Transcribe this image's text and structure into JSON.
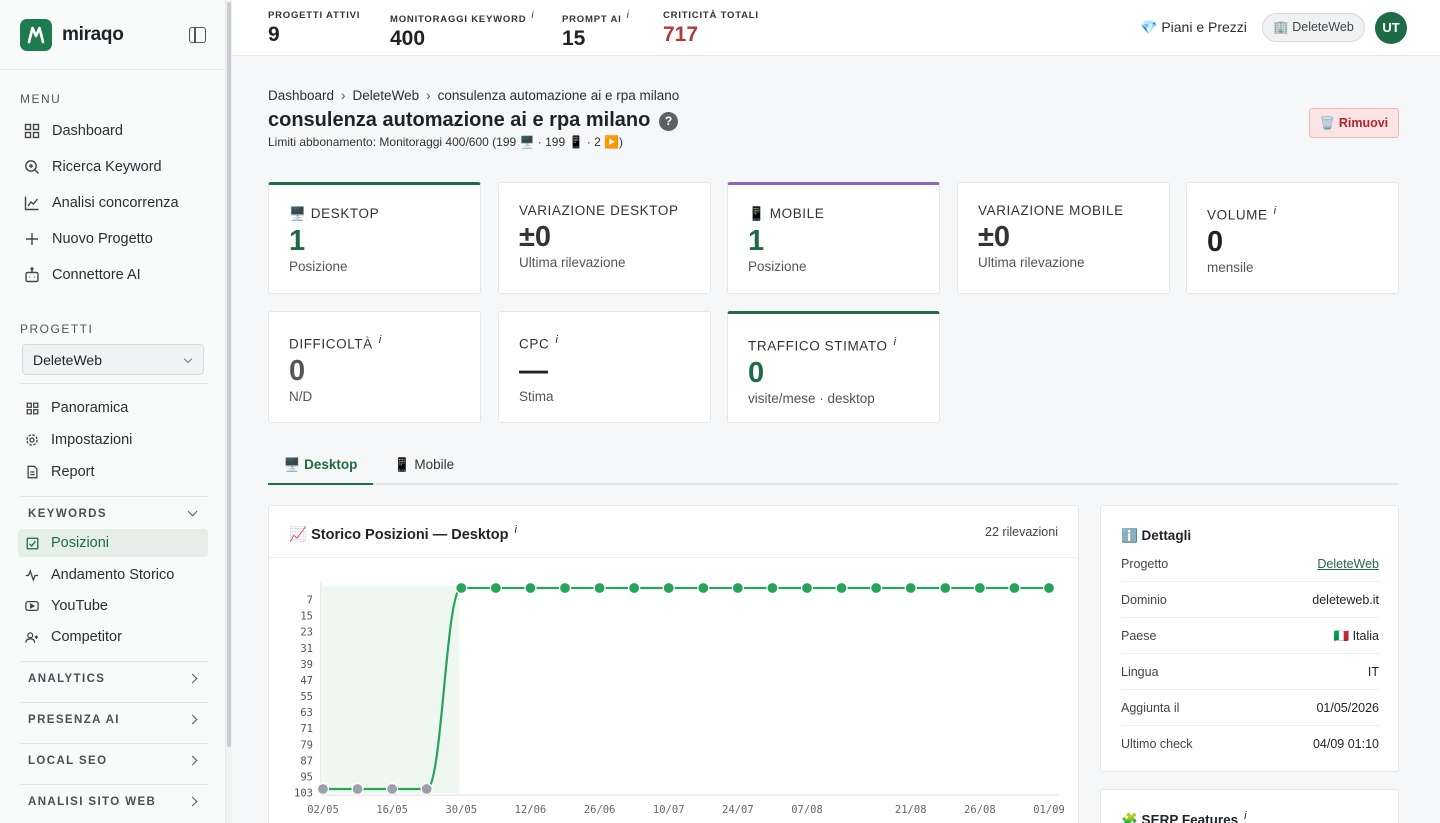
{
  "brand": {
    "name": "miraqo",
    "logo_letter": "M"
  },
  "sidebar": {
    "menu_label": "MENU",
    "menu": [
      {
        "label": "Dashboard",
        "icon": "grid-icon"
      },
      {
        "label": "Ricerca Keyword",
        "icon": "search-icon"
      },
      {
        "label": "Analisi concorrenza",
        "icon": "line-chart-icon"
      },
      {
        "label": "Nuovo Progetto",
        "icon": "plus-icon"
      },
      {
        "label": "Connettore AI",
        "icon": "robot-icon"
      }
    ],
    "projects_label": "PROGETTI",
    "selected_project": "DeleteWeb",
    "project_nav": [
      {
        "label": "Panoramica",
        "icon": "grid-icon"
      },
      {
        "label": "Impostazioni",
        "icon": "gear-icon"
      },
      {
        "label": "Report",
        "icon": "document-icon"
      }
    ],
    "keywords_group": "KEYWORDS",
    "keywords_items": [
      {
        "label": "Posizioni",
        "icon": "check-square-icon",
        "active": true
      },
      {
        "label": "Andamento Storico",
        "icon": "pulse-icon"
      },
      {
        "label": "YouTube",
        "icon": "youtube-icon"
      },
      {
        "label": "Competitor",
        "icon": "users-icon"
      }
    ],
    "collapsed_groups": [
      "ANALYTICS",
      "PRESENZA AI",
      "LOCAL SEO",
      "ANALISI SITO WEB"
    ]
  },
  "topbar": {
    "stats": [
      {
        "label": "PROGETTI ATTIVI",
        "value": "9",
        "info": false
      },
      {
        "label": "MONITORAGGI KEYWORD",
        "value": "400",
        "info": true
      },
      {
        "label": "PROMPT AI",
        "value": "15",
        "info": true
      },
      {
        "label": "CRITICITÀ TOTALI",
        "value": "717",
        "info": false,
        "color": "#b23a3a"
      }
    ],
    "pricing_link": "💎 Piani e Prezzi",
    "workspace": "🏢 DeleteWeb",
    "avatar_initials": "UT"
  },
  "page": {
    "breadcrumb": [
      "Dashboard",
      "DeleteWeb",
      "consulenza automazione ai e rpa milano"
    ],
    "title": "consulenza automazione ai e rpa milano",
    "help": "?",
    "limits": "Limiti abbonamento: Monitoraggi 400/600 (199 🖥️ · 199 📱 · 2 ▶️)",
    "remove_button": "🗑️ Rimuovi"
  },
  "cards": [
    {
      "label": "🖥️ DESKTOP",
      "value": "1",
      "sub": "Posizione"
    },
    {
      "label": "VARIAZIONE DESKTOP",
      "value": "±0",
      "sub": "Ultima rilevazione"
    },
    {
      "label": "📱 MOBILE",
      "value": "1",
      "sub": "Posizione"
    },
    {
      "label": "VARIAZIONE MOBILE",
      "value": "±0",
      "sub": "Ultima rilevazione"
    },
    {
      "label": "VOLUME",
      "value": "0",
      "sub": "mensile"
    },
    {
      "label": "DIFFICOLTÀ",
      "value": "0",
      "sub": "N/D"
    },
    {
      "label": "CPC",
      "value": "—",
      "sub": "Stima"
    },
    {
      "label": "TRAFFICO STIMATO",
      "value": "0",
      "sub": "visite/mese · desktop"
    }
  ],
  "tabs": [
    "🖥️ Desktop",
    "📱 Mobile"
  ],
  "chart_data": {
    "type": "line",
    "title": "📈 Storico Posizioni — Desktop",
    "count_label": "22 rilevazioni",
    "y_ticks": [
      7,
      15,
      23,
      31,
      39,
      47,
      55,
      63,
      71,
      79,
      87,
      95,
      103
    ],
    "y_inverted": true,
    "ylim": [
      1,
      103
    ],
    "x_ticks": [
      "02/05",
      "16/05",
      "30/05",
      "12/06",
      "26/06",
      "10/07",
      "24/07",
      "07/08",
      "21/08",
      "26/08",
      "01/09"
    ],
    "series": [
      {
        "values": [
          101,
          101,
          101,
          101,
          1,
          1,
          1,
          1,
          1,
          1,
          1,
          1,
          1,
          1,
          1,
          1,
          1,
          1,
          1,
          1,
          1,
          1
        ],
        "color": "#27a35a",
        "not_ranked_color": "#9aa1a8"
      }
    ]
  },
  "details": {
    "title": "ℹ️ Dettagli",
    "rows": [
      {
        "k": "Progetto",
        "v": "DeleteWeb",
        "link": true
      },
      {
        "k": "Dominio",
        "v": "deleteweb.it"
      },
      {
        "k": "Paese",
        "v": "🇮🇹 Italia"
      },
      {
        "k": "Lingua",
        "v": "IT"
      },
      {
        "k": "Aggiunta il",
        "v": "01/05/2026"
      },
      {
        "k": "Ultimo check",
        "v": "04/09 01:10"
      }
    ]
  },
  "serp": {
    "title": "🧩 SERP Features"
  },
  "info_mark": "i"
}
